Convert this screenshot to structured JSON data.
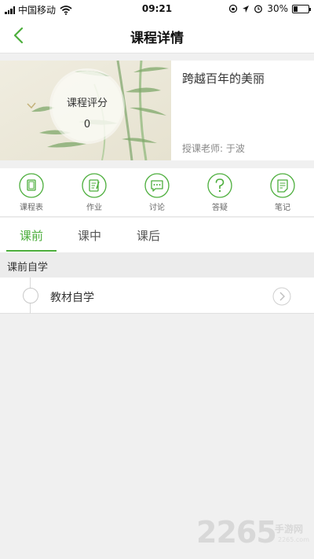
{
  "status_bar": {
    "carrier": "中国移动",
    "time": "09:21",
    "battery": "30%",
    "battery_level": 0.3
  },
  "nav": {
    "title": "课程详情",
    "back_icon": "chevron-left-icon"
  },
  "course": {
    "score_label": "课程评分",
    "score_value": "0",
    "title": "跨越百年的美丽",
    "teacher": "授课老师: 于波"
  },
  "toolbar": {
    "items": [
      {
        "label": "课程表",
        "icon": "schedule-icon"
      },
      {
        "label": "作业",
        "icon": "homework-icon"
      },
      {
        "label": "讨论",
        "icon": "discussion-icon"
      },
      {
        "label": "答疑",
        "icon": "question-icon"
      },
      {
        "label": "笔记",
        "icon": "note-icon"
      }
    ]
  },
  "tabs": {
    "items": [
      "课前",
      "课中",
      "课后"
    ],
    "active": "课前"
  },
  "section": {
    "header": "课前自学",
    "items": [
      {
        "label": "教材自学"
      }
    ]
  },
  "watermark": {
    "number": "2265",
    "sub": "手游网",
    "url": "2265.com"
  },
  "colors": {
    "accent": "#4cae3c",
    "background": "#f0f0f0"
  }
}
